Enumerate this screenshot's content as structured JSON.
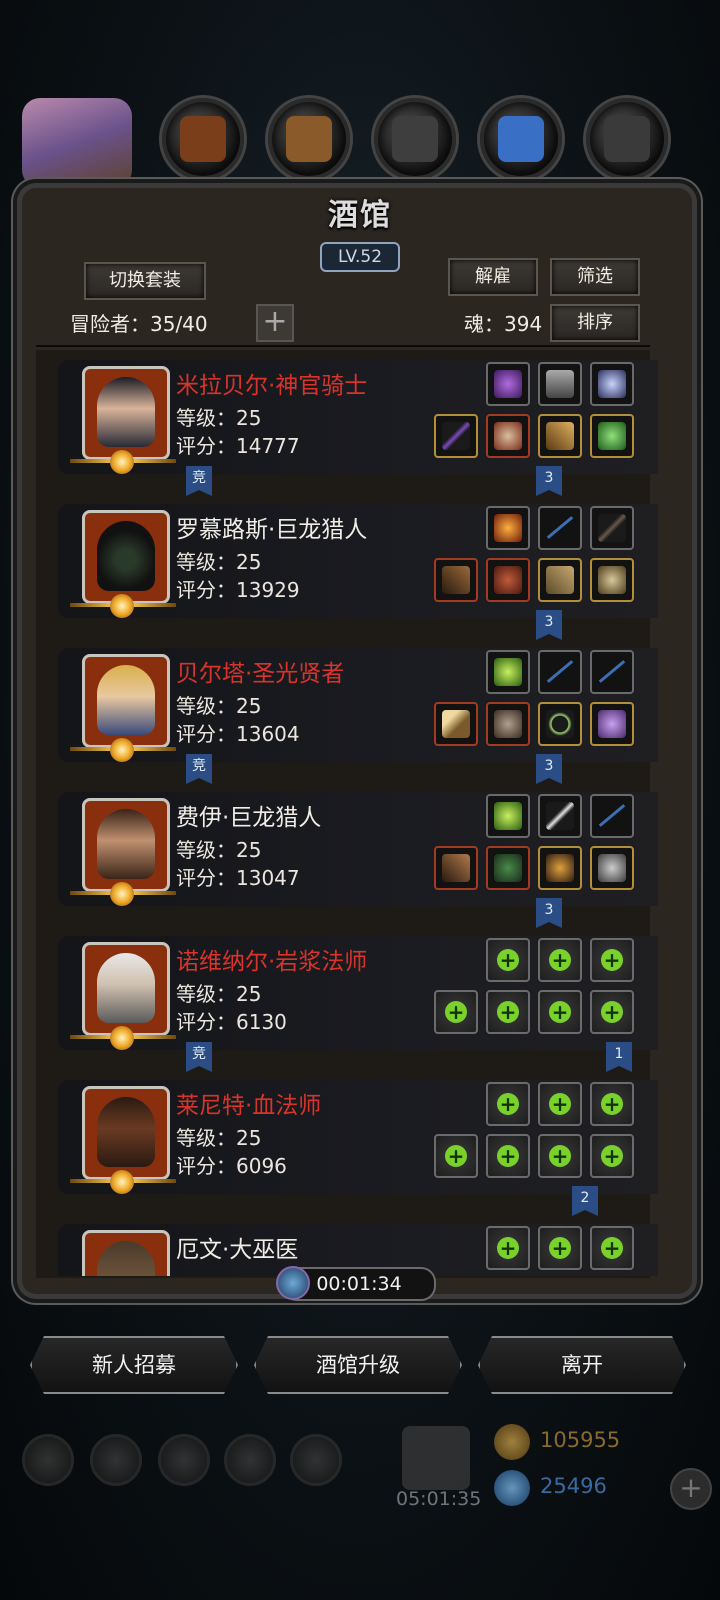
{
  "title": "酒馆",
  "level": "LV.52",
  "buttons": {
    "switch_outfit": "切换套装",
    "dismiss": "解雇",
    "filter": "筛选",
    "sort": "排序",
    "recruit": "新人招募",
    "upgrade": "酒馆升级",
    "leave": "离开",
    "add_slot": "+"
  },
  "adventurers_count": "冒险者：35/40",
  "soul": "魂：394",
  "timer": "00:01:34",
  "heroes": [
    {
      "name": "米拉贝尔·神官骑士",
      "name_color": "red",
      "level": "等级：25",
      "score": "评分：14777",
      "left_tag": "竞",
      "right_tag": "3"
    },
    {
      "name": "罗慕路斯·巨龙猎人",
      "name_color": "white",
      "level": "等级：25",
      "score": "评分：13929",
      "left_tag": "",
      "right_tag": "3"
    },
    {
      "name": "贝尔塔·圣光贤者",
      "name_color": "red",
      "level": "等级：25",
      "score": "评分：13604",
      "left_tag": "竞",
      "right_tag": "3"
    },
    {
      "name": "费伊·巨龙猎人",
      "name_color": "white",
      "level": "等级：25",
      "score": "评分：13047",
      "left_tag": "",
      "right_tag": "3"
    },
    {
      "name": "诺维纳尔·岩浆法师",
      "name_color": "red",
      "level": "等级：25",
      "score": "评分：6130",
      "left_tag": "竞",
      "right_tag": "1"
    },
    {
      "name": "莱尼特·血法师",
      "name_color": "red",
      "level": "等级：25",
      "score": "评分：6096",
      "left_tag": "",
      "right_tag": "2"
    },
    {
      "name": "厄文·大巫医",
      "name_color": "white",
      "level": "",
      "score": "",
      "left_tag": "",
      "right_tag": ""
    }
  ],
  "bottom": {
    "gift_timer": "05:01:35",
    "gold": "105955",
    "gems": "25496",
    "add": "+"
  },
  "icons": {
    "plus": "+"
  }
}
